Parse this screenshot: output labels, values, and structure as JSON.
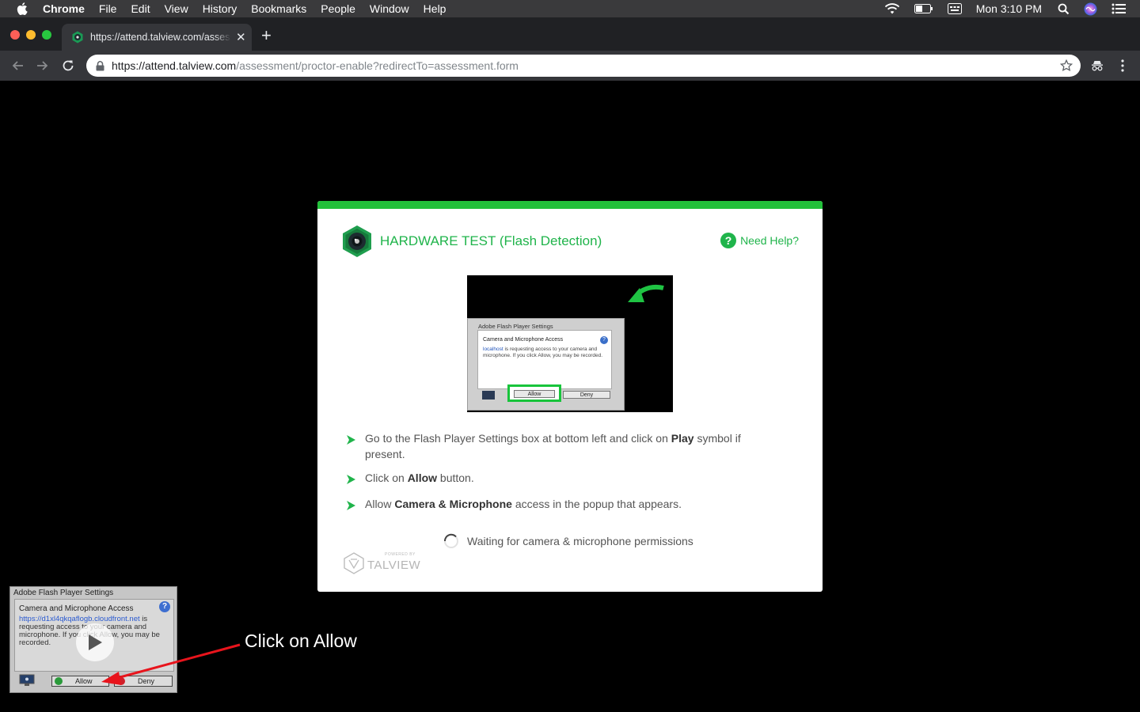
{
  "menubar": {
    "app": "Chrome",
    "items": [
      "File",
      "Edit",
      "View",
      "History",
      "Bookmarks",
      "People",
      "Window",
      "Help"
    ],
    "clock": "Mon 3:10 PM",
    "status_icons": [
      "wifi-icon",
      "battery-icon",
      "input-source-icon",
      "spotlight-search-icon",
      "siri-icon",
      "notification-center-icon"
    ]
  },
  "browser": {
    "tab_title": "https://attend.talview.com/assessment",
    "url_host": "https://attend.talview.com",
    "url_path": "/assessment/proctor-enable?redirectTo=assessment.form"
  },
  "card": {
    "title": "HARDWARE TEST (Flash Detection)",
    "help": "Need Help?",
    "accent": "#22c03a",
    "demo": {
      "dialog_title": "Adobe Flash Player Settings",
      "heading": "Camera and Microphone Access",
      "link": "localhost",
      "body": " is requesting access to your camera and microphone. If you click Allow, you may be recorded.",
      "allow": "Allow",
      "deny": "Deny"
    },
    "steps": [
      {
        "pre": "Go to the Flash Player Settings box at bottom left and click on ",
        "bold": "Play",
        "post": " symbol if present."
      },
      {
        "pre": "Click on ",
        "bold": "Allow",
        "post": " button."
      },
      {
        "pre": "Allow ",
        "bold": "Camera & Microphone",
        "post": " access in the popup that appears."
      }
    ],
    "waiting": "Waiting for camera & microphone permissions",
    "brand_powered": "POWERED BY",
    "brand_name": "TALVIEW"
  },
  "flash": {
    "title": "Adobe Flash Player Settings",
    "heading": "Camera and Microphone Access",
    "link": "https://d1xl4qkqaflogb.cloudfront.net",
    "body": " is requesting access to your camera and microphone. If you click Allow, you may be recorded.",
    "allow": "Allow",
    "deny": "Deny"
  },
  "annotation": {
    "text": "Click on Allow",
    "color": "#e8141c"
  }
}
